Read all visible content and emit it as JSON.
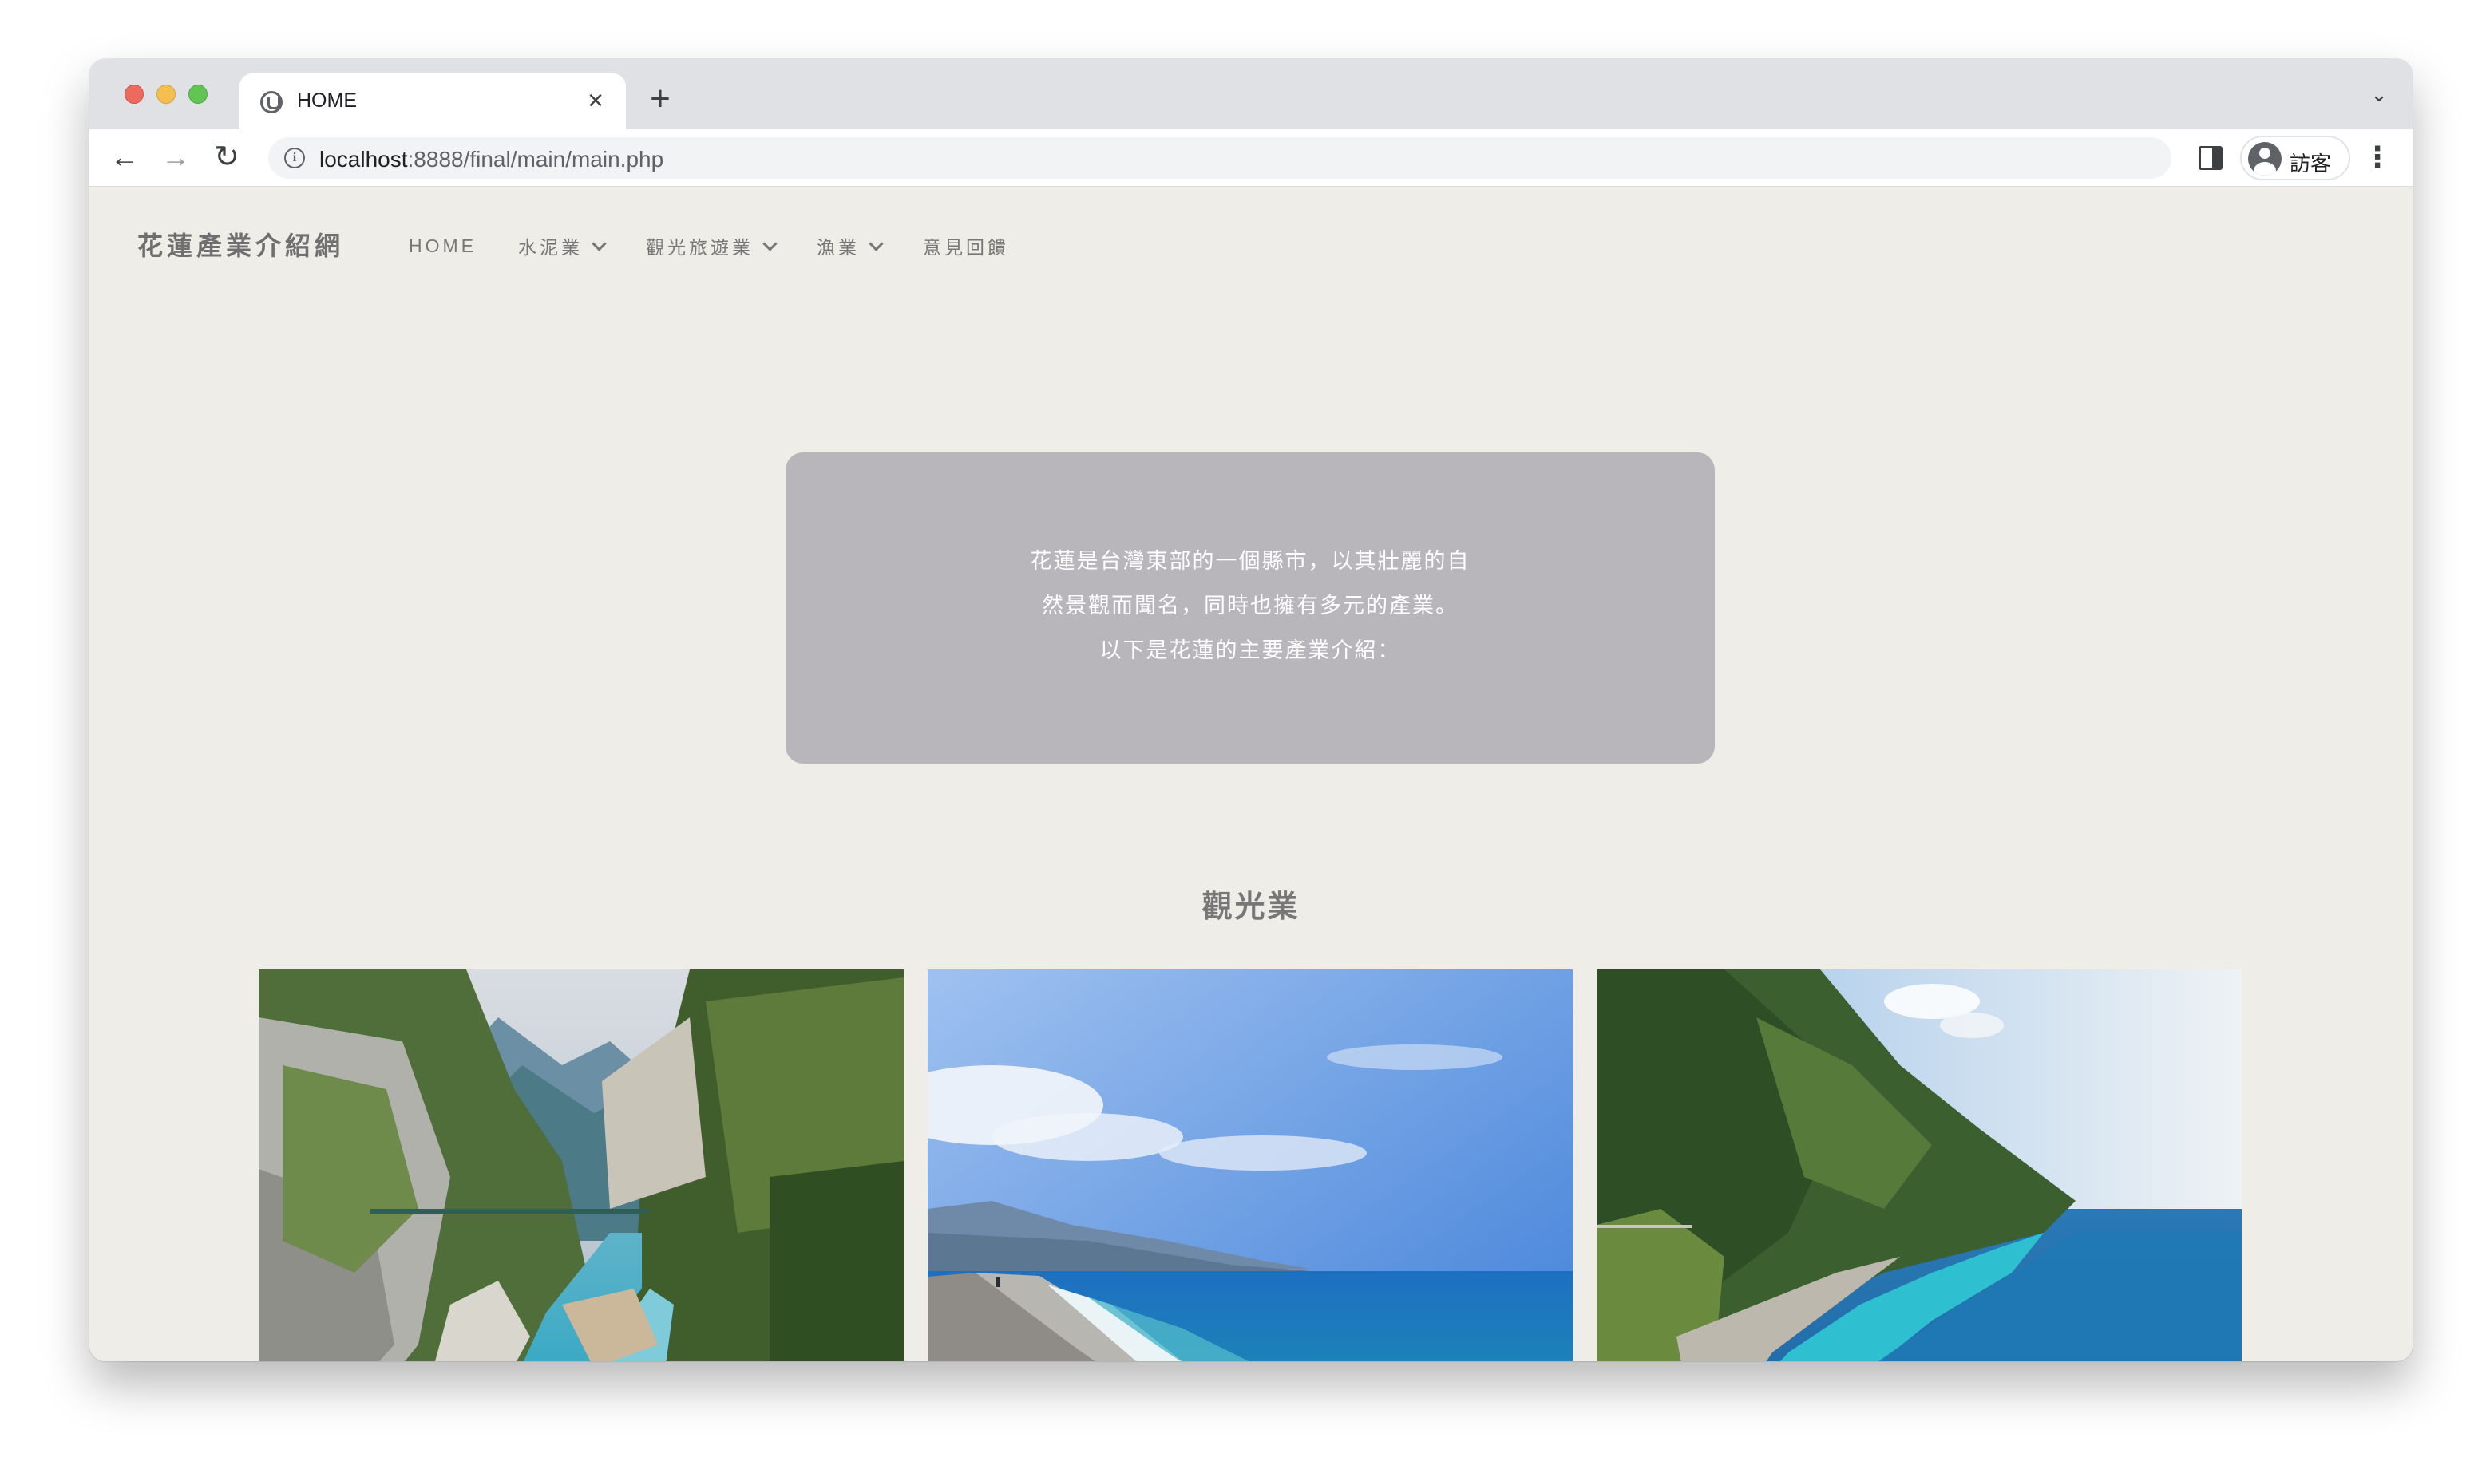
{
  "browser": {
    "tab_title": "HOME",
    "url_host": "localhost",
    "url_rest": ":8888/final/main/main.php",
    "profile_label": "訪客",
    "icons": {
      "favicon": "favicon-icon",
      "close": "close-icon",
      "new_tab": "plus-icon",
      "back": "arrow-left-icon",
      "forward": "arrow-right-icon",
      "reload": "reload-icon",
      "info": "info-icon",
      "side_panel": "side-panel-icon",
      "avatar": "avatar-icon",
      "menu": "kebab-menu-icon",
      "tab_search": "chevron-down-icon"
    }
  },
  "site": {
    "brand": "花蓮產業介紹網",
    "nav": [
      {
        "label": "HOME",
        "has_dropdown": false
      },
      {
        "label": "水泥業",
        "has_dropdown": true
      },
      {
        "label": "觀光旅遊業",
        "has_dropdown": true
      },
      {
        "label": "漁業",
        "has_dropdown": true
      },
      {
        "label": "意見回饋",
        "has_dropdown": false
      }
    ],
    "intro": {
      "line1": "花蓮是台灣東部的一個縣市，以其壯麗的自",
      "line2": "然景觀而聞名，同時也擁有多元的產業。",
      "line3": "以下是花蓮的主要產業介紹："
    },
    "section_title": "觀光業",
    "colors": {
      "page_bg": "#efede8",
      "card_bg": "#b8b5bb",
      "nav_text": "#777777",
      "brand_text": "#6f6f6f"
    }
  }
}
